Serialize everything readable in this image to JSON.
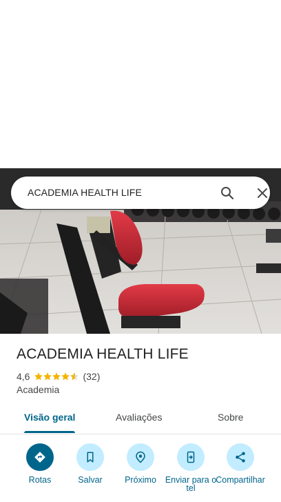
{
  "search": {
    "query": "ACADEMIA HEALTH LIFE"
  },
  "place": {
    "name": "ACADEMIA HEALTH LIFE",
    "rating": "4,6",
    "rating_value": 4.6,
    "review_count": "(32)",
    "category": "Academia"
  },
  "tabs": [
    {
      "label": "Visão geral",
      "active": true
    },
    {
      "label": "Avaliações",
      "active": false
    },
    {
      "label": "Sobre",
      "active": false
    }
  ],
  "actions": [
    {
      "label": "Rotas",
      "icon": "directions-icon"
    },
    {
      "label": "Salvar",
      "icon": "bookmark-icon"
    },
    {
      "label": "Próximo",
      "icon": "nearby-icon"
    },
    {
      "label": "Enviar para o tel",
      "icon": "send-to-phone-icon"
    },
    {
      "label": "Compartilhar",
      "icon": "share-icon"
    }
  ],
  "colors": {
    "accent": "#00658b",
    "accent_light": "#c2ecff",
    "star": "#f4b400"
  }
}
